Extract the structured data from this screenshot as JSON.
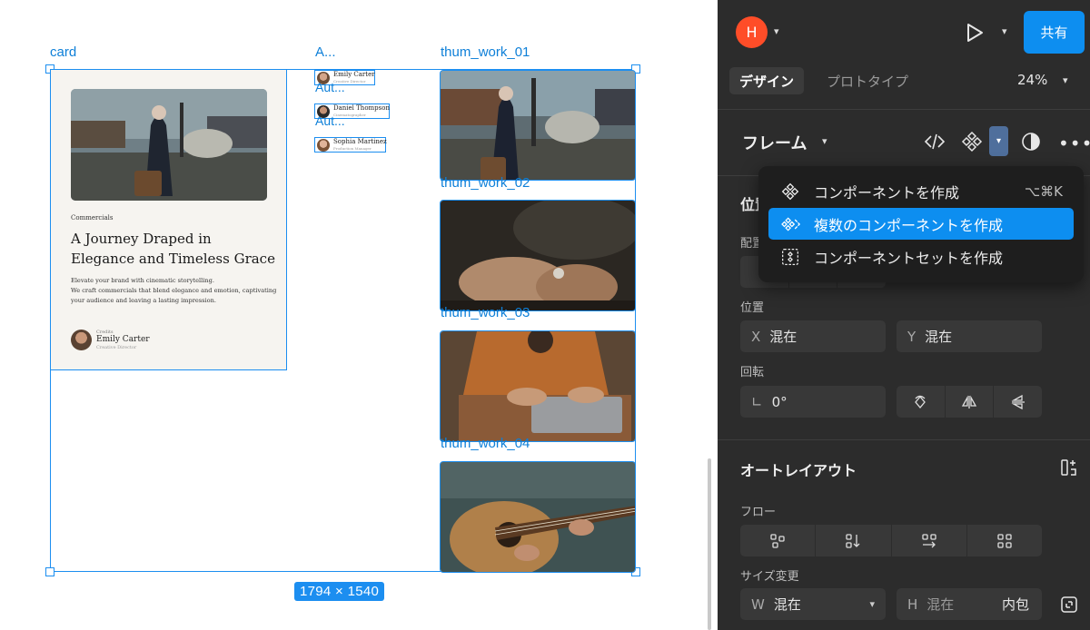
{
  "canvas": {
    "frame_labels": {
      "card": "card",
      "author": "A...",
      "thumb1": "thum_work_01",
      "thumb2": "thum_work_02",
      "thumb3": "thum_work_03",
      "thumb4": "thum_work_04"
    },
    "author_layer_labels": [
      "Aut...",
      "Aut..."
    ],
    "size_badge": "1794 × 1540",
    "card": {
      "category": "Commercials",
      "title": "A Journey Draped in\nElegance and Timeless Grace",
      "description": "Elevate your brand with cinematic storytelling.\nWe craft commercials that blend elegance and emotion, captivating\nyour audience and leaving a lasting impression.",
      "credit_label": "Credits",
      "credit_name": "Emily Carter",
      "credit_role": "Creative Director"
    },
    "authors": [
      {
        "name": "Emily Carter",
        "role": "Creative Director"
      },
      {
        "name": "Daniel Thompson",
        "role": "Cinematographer"
      },
      {
        "name": "Sophia Martinez",
        "role": "Production Manager"
      }
    ]
  },
  "panel": {
    "user_initial": "H",
    "share_label": "共有",
    "tabs": {
      "design": "デザイン",
      "prototype": "プロトタイプ"
    },
    "zoom": "24%",
    "frame_title": "フレーム",
    "position_section_partial": "位置",
    "alignment_label_partial": "配置",
    "position_label": "位置",
    "x_label": "X",
    "x_value": "混在",
    "y_label": "Y",
    "y_value": "混在",
    "rotation_label": "回転",
    "rotation_value": "0°",
    "autolayout_title": "オートレイアウト",
    "flow_label": "フロー",
    "resize_label": "サイズ変更",
    "w_label": "W",
    "w_value": "混在",
    "h_label": "H",
    "h_value": "混在",
    "h_mode": "内包"
  },
  "menu": {
    "items": [
      {
        "label": "コンポーネントを作成",
        "shortcut": "⌥⌘K",
        "icon": "component-icon",
        "highlighted": false
      },
      {
        "label": "複数のコンポーネントを作成",
        "shortcut": "",
        "icon": "multiple-components-icon",
        "highlighted": true
      },
      {
        "label": "コンポーネントセットを作成",
        "shortcut": "",
        "icon": "component-set-icon",
        "highlighted": false
      }
    ]
  },
  "colors": {
    "accent": "#0d8ef0",
    "selection": "#1c8ef0",
    "panel_bg": "#2c2c2c",
    "avatar": "#ff4d28"
  }
}
